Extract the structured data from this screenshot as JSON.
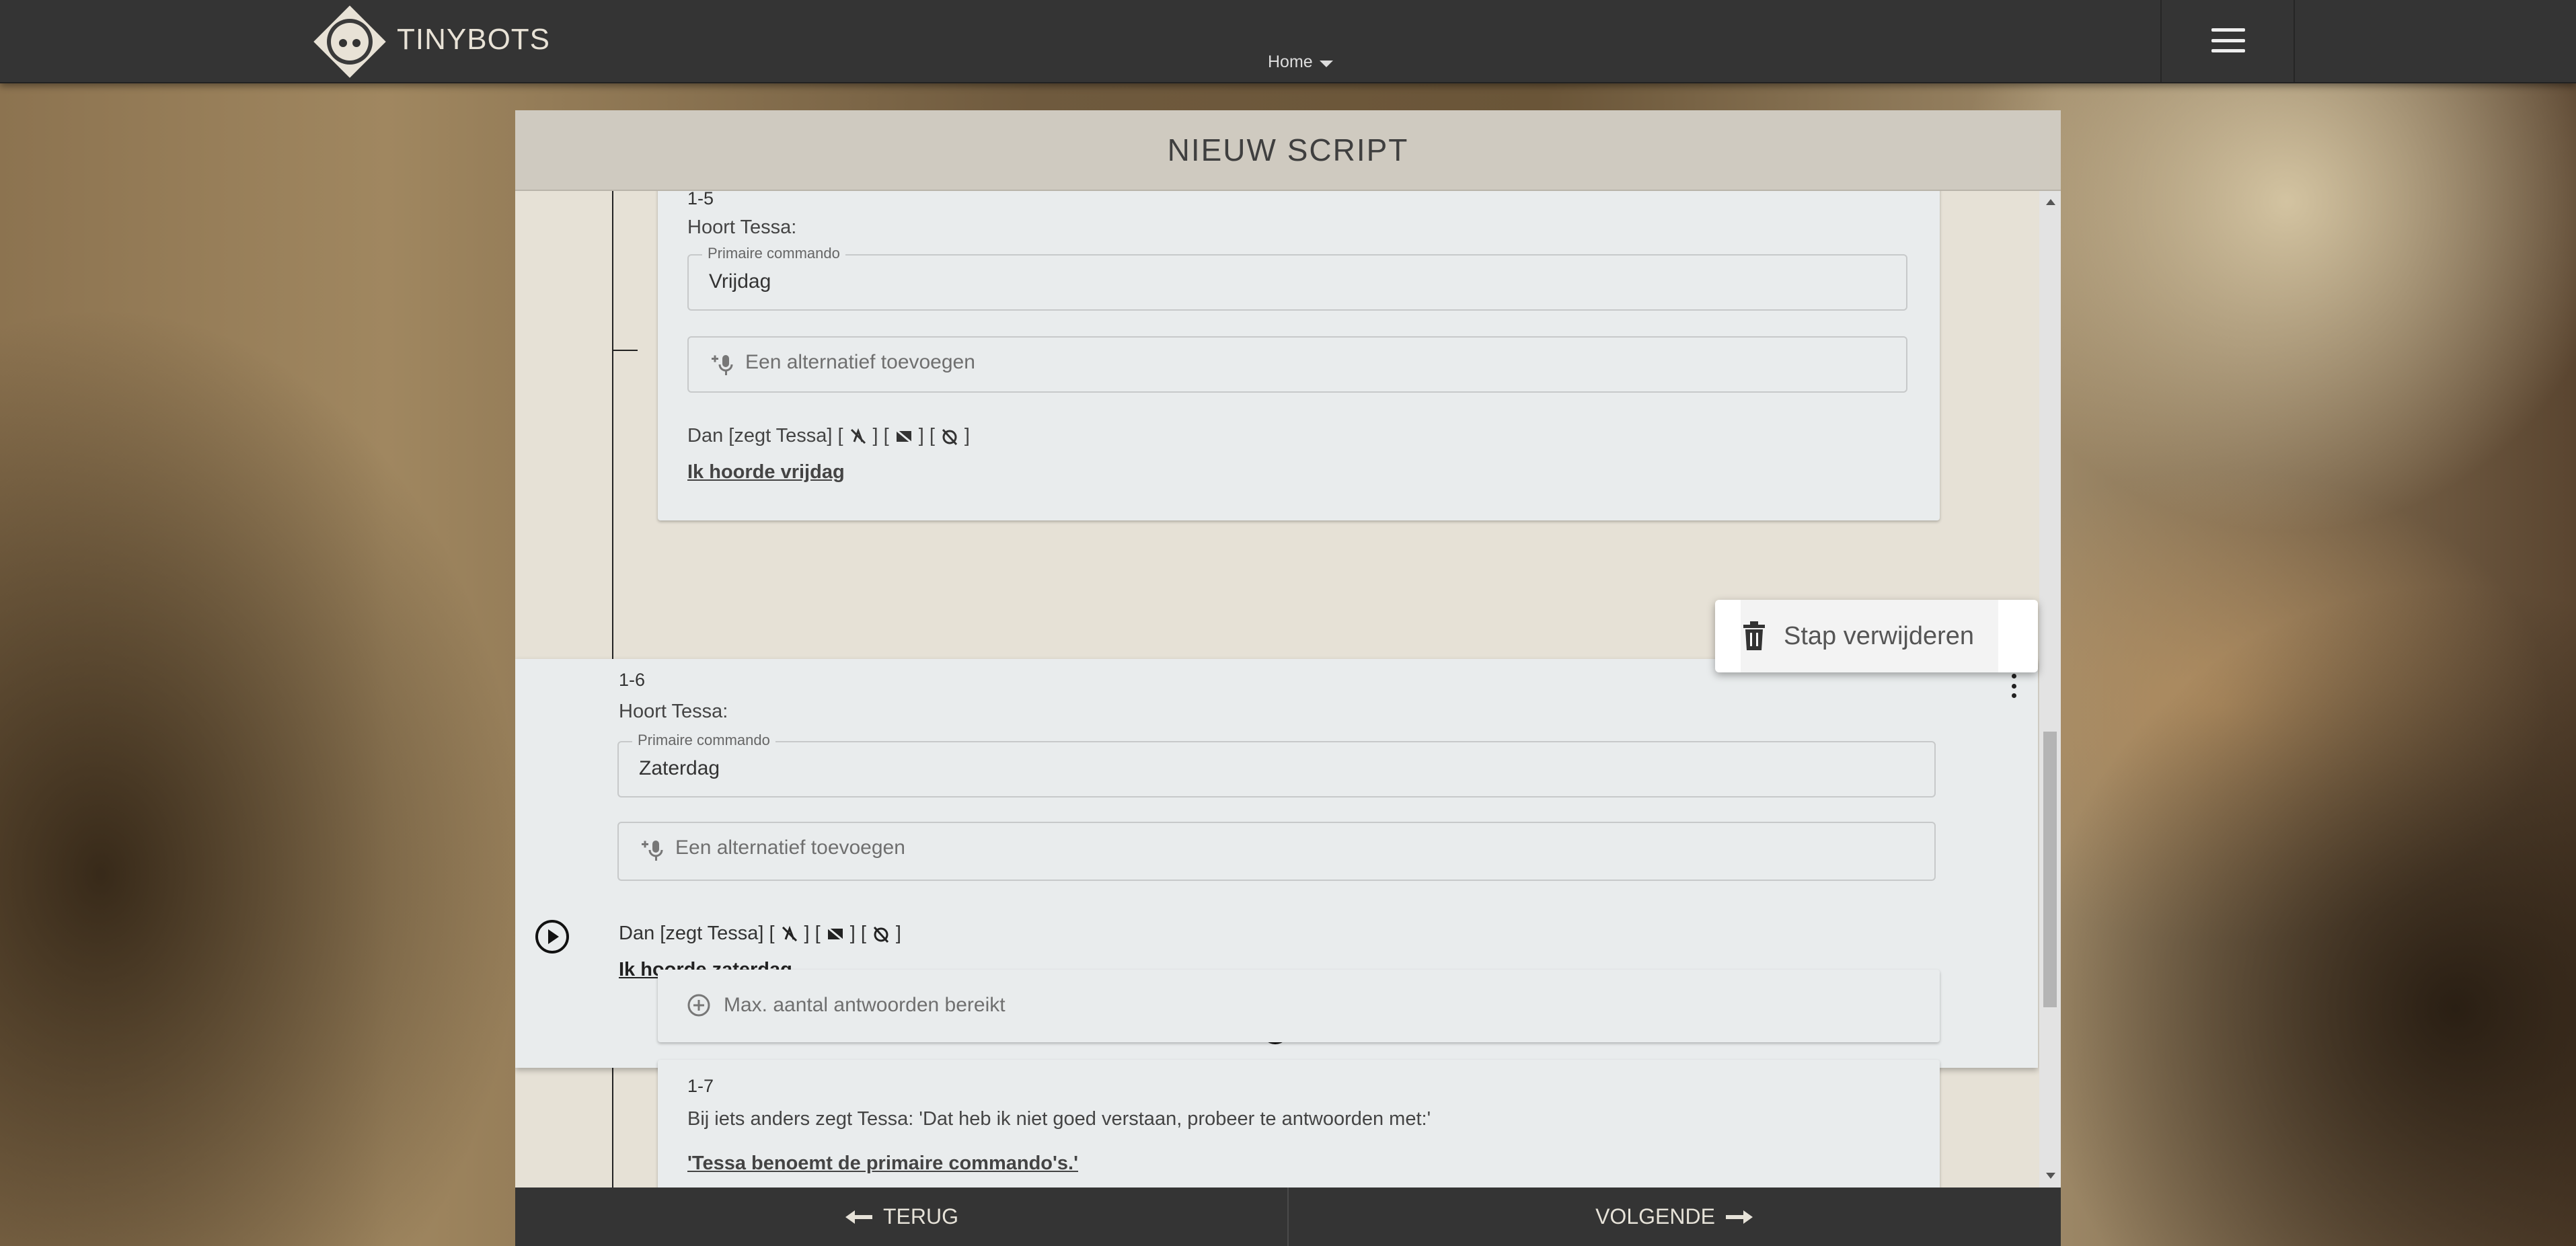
{
  "brand": {
    "name": "TINYBOTS"
  },
  "nav": {
    "home_label": "Home"
  },
  "panel": {
    "title": "NIEUW SCRIPT"
  },
  "steps": {
    "s15": {
      "number": "1-5",
      "hears_label": "Hoort Tessa:",
      "primary_legend": "Primaire commando",
      "primary_value": "Vrijdag",
      "alt_placeholder": "Een alternatief toevoegen",
      "then_label": "Dan [zegt Tessa]",
      "response": "Ik hoorde vrijdag"
    },
    "s16": {
      "number": "1-6",
      "hears_label": "Hoort Tessa:",
      "primary_legend": "Primaire commando",
      "primary_value": "Zaterdag",
      "alt_placeholder": "Een alternatief toevoegen",
      "then_label": "Dan [zegt Tessa]",
      "response": "Ik hoorde zaterdag"
    },
    "max_answers": "Max. aantal antwoorden bereikt",
    "s17": {
      "number": "1-7",
      "text": "Bij iets anders zegt Tessa: 'Dat heb ik niet goed verstaan, probeer te antwoorden met:'",
      "response": "'Tessa benoemt de primaire commando's.'"
    }
  },
  "context_menu": {
    "delete_label": "Stap verwijderen"
  },
  "footer": {
    "back_label": "TERUG",
    "next_label": "VOLGENDE"
  },
  "icons": [
    "tinybots-logo-icon",
    "caret-down-icon",
    "hamburger-icon",
    "mic-plus-icon",
    "no-move-icon",
    "no-display-icon",
    "no-timer-icon",
    "kebab-icon",
    "trash-icon",
    "play-circle-icon",
    "add-circle-icon",
    "plus-circle-outline-icon",
    "arrow-left-icon",
    "arrow-right-icon"
  ]
}
